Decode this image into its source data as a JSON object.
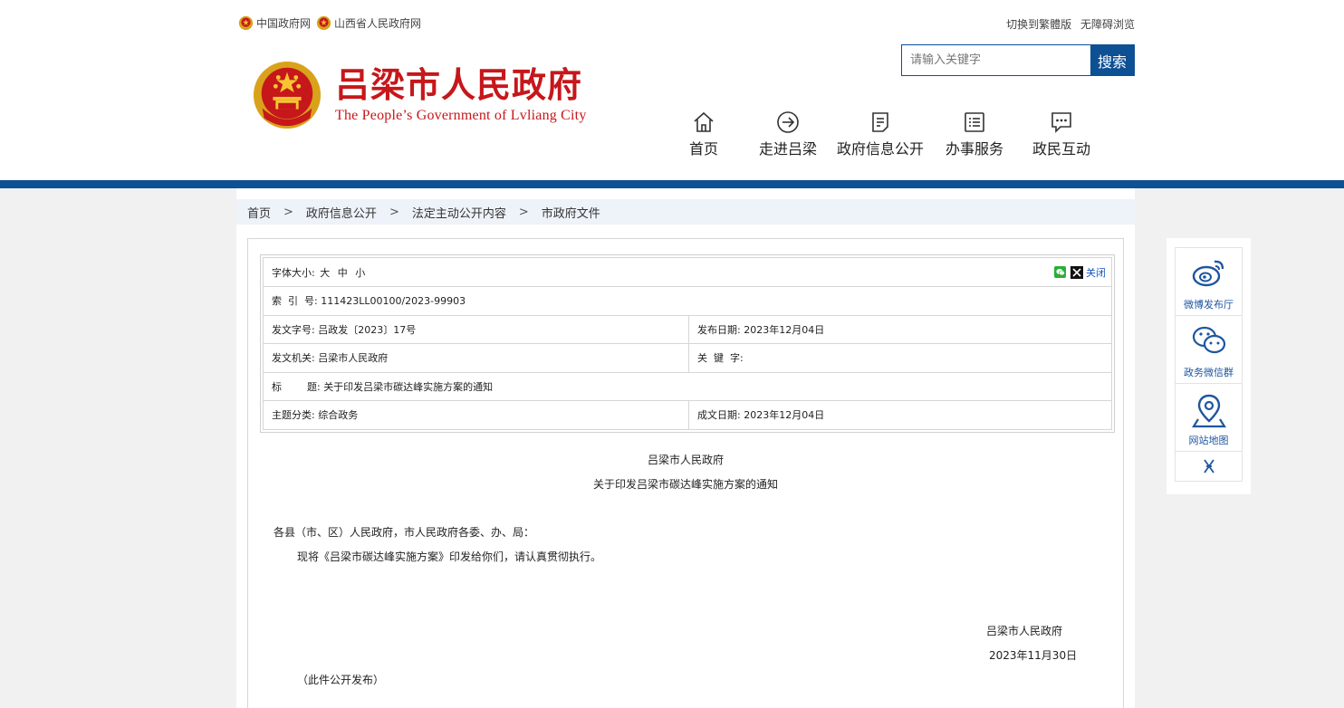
{
  "top_links": {
    "gov_cn": "中国政府网",
    "shanxi": "山西省人民政府网",
    "traditional": "切换到繁體版",
    "accessible": "无障碍浏览"
  },
  "logo": {
    "cn": "吕梁市人民政府",
    "en": "The People’s Government of Lvliang City"
  },
  "search": {
    "placeholder": "请输入关键字",
    "button": "搜索"
  },
  "nav": [
    "首页",
    "走进吕梁",
    "政府信息公开",
    "办事服务",
    "政民互动"
  ],
  "breadcrumb": [
    "首页",
    "政府信息公开",
    "法定主动公开内容",
    "市政府文件"
  ],
  "tools": {
    "font_size_label": "字体大小:",
    "sizes": [
      "大",
      "中",
      "小"
    ],
    "close": "关闭"
  },
  "meta": {
    "index_label": "索  引  号:",
    "index_value": "111423LL00100/2023-99903",
    "doc_no_label": "发文字号:",
    "doc_no_value": "吕政发〔2023〕17号",
    "pub_date_label": "发布日期:",
    "pub_date_value": "2023年12月04日",
    "issuer_label": "发文机关:",
    "issuer_value": "吕梁市人民政府",
    "keyword_label": "关  键  字:",
    "keyword_value": "",
    "title_label": "标        题:",
    "title_value": "关于印发吕梁市碳达峰实施方案的通知",
    "topic_label": "主题分类:",
    "topic_value": "综合政务",
    "made_date_label": "成文日期:",
    "made_date_value": "2023年12月04日"
  },
  "document": {
    "heading1": "吕梁市人民政府",
    "heading2": "关于印发吕梁市碳达峰实施方案的通知",
    "salutation": "各县（市、区）人民政府，市人民政府各委、办、局：",
    "body": "现将《吕梁市碳达峰实施方案》印发给你们，请认真贯彻执行。",
    "signature": "吕梁市人民政府",
    "date": "2023年11月30日",
    "note": "（此件公开发布）"
  },
  "side": {
    "weibo": "微博发布厅",
    "wechat": "政务微信群",
    "map": "网站地图"
  },
  "colors": {
    "brand_red": "#c6171b",
    "brand_blue": "#0d5094"
  }
}
